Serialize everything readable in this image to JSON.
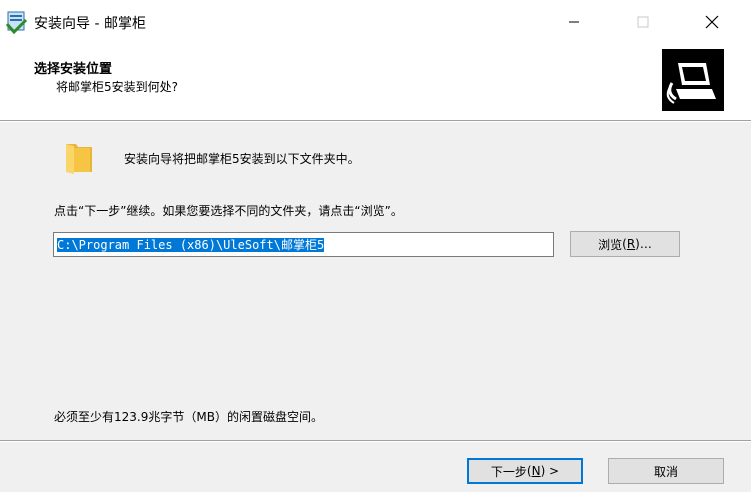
{
  "window": {
    "title": "安装向导 - 邮掌柜",
    "icon": "installer-app-icon"
  },
  "header": {
    "title": "选择安装位置",
    "subtitle": "将邮掌柜5安装到何处?",
    "logo": "installer-computer-logo"
  },
  "body": {
    "intro": "安装向导将把邮掌柜5安装到以下文件夹中。",
    "instruction": "点击“下一步”继续。如果您要选择不同的文件夹，请点击“浏览”。",
    "install_path": "C:\\Program Files (x86)\\UleSoft\\邮掌柜5",
    "browse_label": "浏览",
    "browse_accel": "R",
    "browse_suffix": ")…",
    "space_required": "必须至少有123.9兆字节（MB）的闲置磁盘空间。"
  },
  "footer": {
    "next_label": "下一步",
    "next_accel": "N",
    "next_suffix": ") >",
    "cancel_label": "取消"
  },
  "colors": {
    "selection": "#0078d7",
    "panel_bg": "#f0f0f0",
    "folder": "#f6c543"
  }
}
